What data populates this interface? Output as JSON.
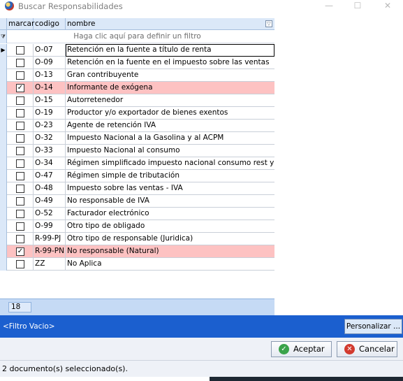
{
  "window": {
    "title": "Buscar Responsabilidades",
    "minimize": "—",
    "maximize": "☐",
    "close": "✕"
  },
  "grid": {
    "columns": {
      "marcar": "marcar",
      "codigo": "codigo",
      "nombre": "nombre"
    },
    "filter_row_text": "Haga clic aquí para definir un filtro",
    "rows": [
      {
        "checked": false,
        "code": "O-07",
        "name": "Retención en la fuente a título de renta",
        "current": true
      },
      {
        "checked": false,
        "code": "O-09",
        "name": "Retención en la fuente en el impuesto sobre las ventas"
      },
      {
        "checked": false,
        "code": "O-13",
        "name": "Gran contribuyente"
      },
      {
        "checked": true,
        "code": "O-14",
        "name": "Informante de exógena"
      },
      {
        "checked": false,
        "code": "O-15",
        "name": "Autorretenedor"
      },
      {
        "checked": false,
        "code": "O-19",
        "name": "Productor y/o exportador de bienes exentos"
      },
      {
        "checked": false,
        "code": "O-23",
        "name": "Agente de retención IVA"
      },
      {
        "checked": false,
        "code": "O-32",
        "name": "Impuesto Nacional a la Gasolina y al ACPM"
      },
      {
        "checked": false,
        "code": "O-33",
        "name": "Impuesto Nacional al consumo"
      },
      {
        "checked": false,
        "code": "O-34",
        "name": "Régimen simplificado impuesto nacional consumo rest y bares"
      },
      {
        "checked": false,
        "code": "O-47",
        "name": "Régimen simple de tributación"
      },
      {
        "checked": false,
        "code": "O-48",
        "name": "Impuesto sobre las ventas - IVA"
      },
      {
        "checked": false,
        "code": "O-49",
        "name": "No responsable de IVA"
      },
      {
        "checked": false,
        "code": "O-52",
        "name": "Facturador electrónico"
      },
      {
        "checked": false,
        "code": "O-99",
        "name": "Otro tipo de obligado"
      },
      {
        "checked": false,
        "code": "R-99-PJ",
        "name": "Otro tipo de responsable (Juridica)"
      },
      {
        "checked": true,
        "code": "R-99-PN",
        "name": "No responsable (Natural)"
      },
      {
        "checked": false,
        "code": "ZZ",
        "name": "No Aplica"
      }
    ],
    "row_count": "18"
  },
  "filter_bar": {
    "label": "<Filtro Vacio>",
    "customize_label": "Personalizar ..."
  },
  "actions": {
    "accept_label": "Aceptar",
    "cancel_label": "Cancelar"
  },
  "status": {
    "text": "2 documento(s) seleccionado(s)."
  },
  "colors": {
    "selected_row": "#fdc2c2",
    "header_bg": "#dbe8f8",
    "filter_bar": "#1b5fcf"
  }
}
